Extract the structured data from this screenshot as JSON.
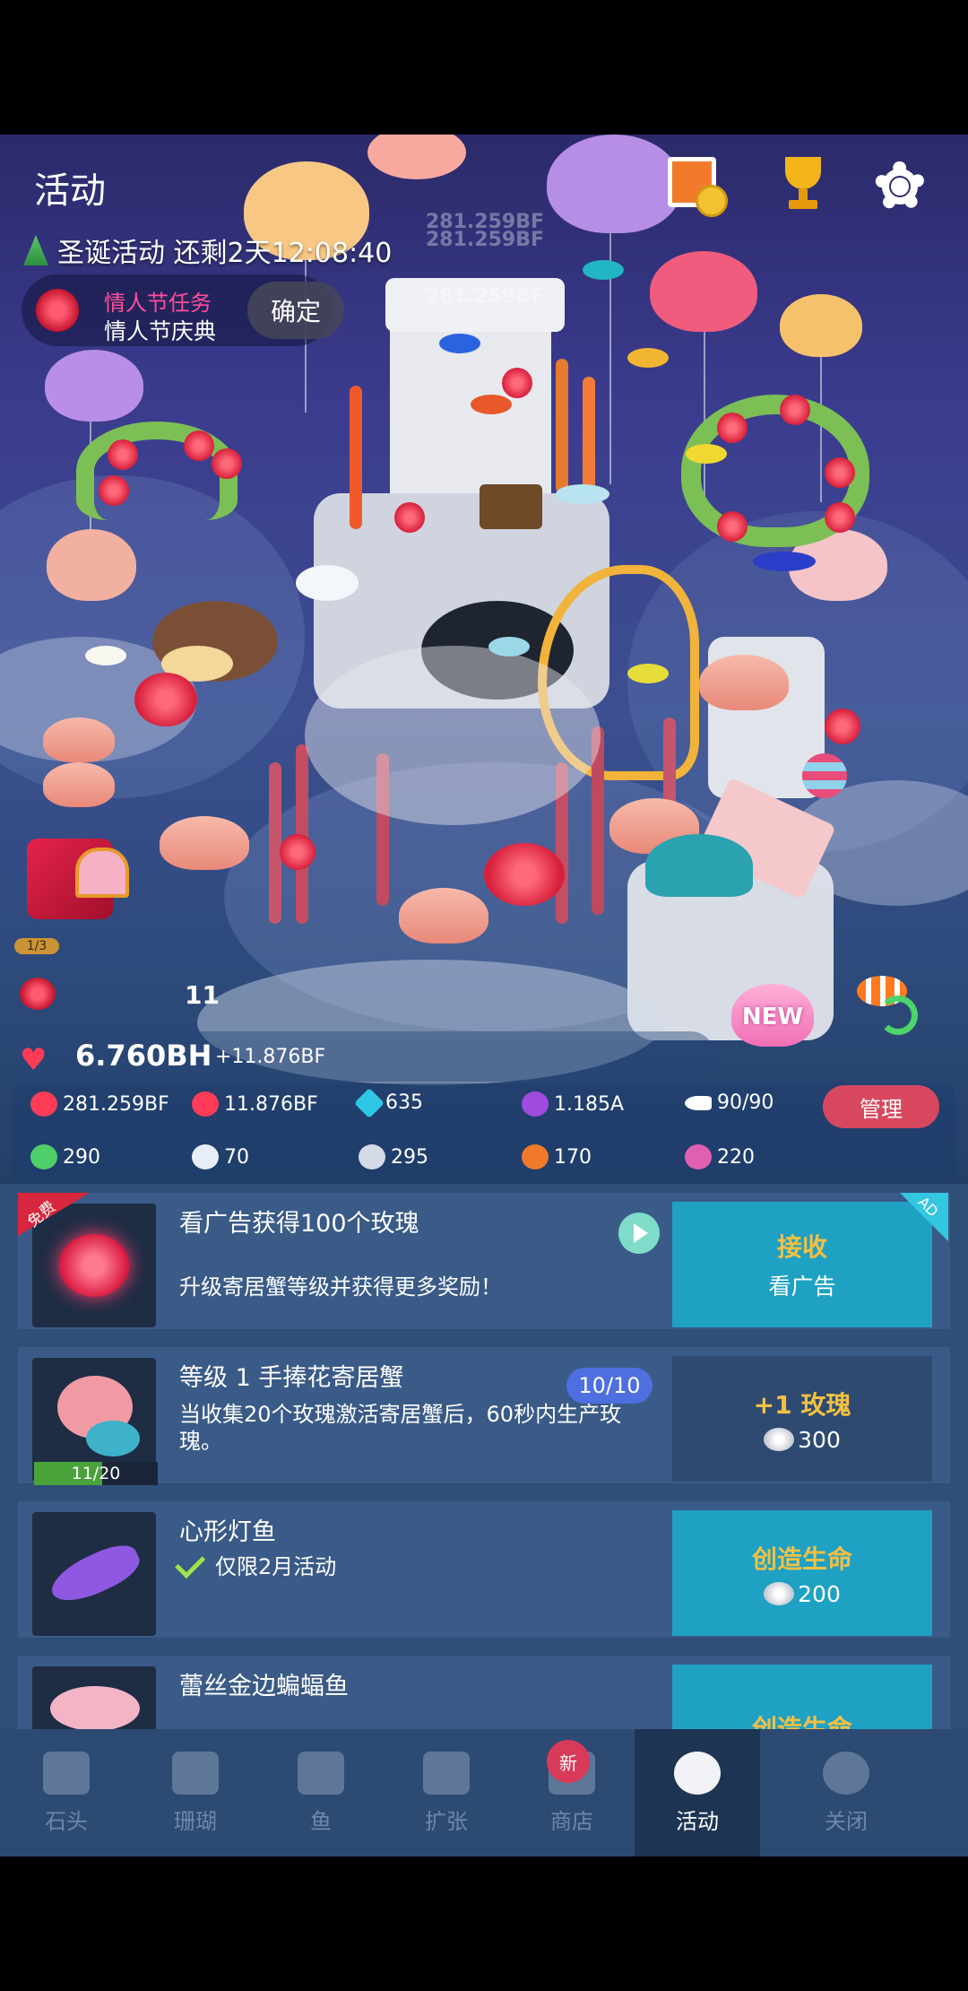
{
  "header": {
    "title": "活动",
    "event_countdown": "圣诞活动 还剩2天12:08:40"
  },
  "valentine": {
    "task": "情人节任务",
    "subtitle": "情人节庆典",
    "confirm_label": "确定"
  },
  "floating_numbers": [
    "281.259BF",
    "281.259BF",
    "281.259BF"
  ],
  "gift": {
    "progress": "1/3"
  },
  "rose_count": "11",
  "new_badge": "NEW",
  "love": {
    "total": "6.760BH",
    "rate": "+11.876BF"
  },
  "stats": {
    "tap_value": "281.259BF",
    "per_second": "11.876BF",
    "diamonds": "635",
    "pearls": "1.185A",
    "fish": "90/90",
    "manage_label": "管理",
    "res1": "290",
    "res2": "70",
    "res3": "295",
    "res4": "170",
    "res5": "220"
  },
  "list": [
    {
      "badge": "免费",
      "title": "看广告获得100个玫瑰",
      "desc": "升级寄居蟹等级并获得更多奖励！",
      "action_main": "接收",
      "action_sub": "看广告",
      "corner": "AD"
    },
    {
      "title": "等级 1 手捧花寄居蟹",
      "level": "10/10",
      "desc": "当收集20个玫瑰激活寄居蟹后，60秒内生产玫瑰。",
      "progress": "11/20",
      "progress_value": 0.55,
      "action_main": "+1 玫瑰",
      "action_cost": "300"
    },
    {
      "title": "心形灯鱼",
      "desc": "仅限2月活动",
      "action_main": "创造生命",
      "action_cost": "200"
    },
    {
      "title": "蕾丝金边蝙蝠鱼",
      "action_main": "创造生命"
    }
  ],
  "nav": {
    "items": [
      {
        "label": "石头",
        "icon": "stone-icon"
      },
      {
        "label": "珊瑚",
        "icon": "coral-icon"
      },
      {
        "label": "鱼",
        "icon": "fish-icon"
      },
      {
        "label": "扩张",
        "icon": "expand-icon"
      },
      {
        "label": "商店",
        "icon": "cart-icon"
      },
      {
        "label": "活动",
        "icon": "rose-icon"
      },
      {
        "label": "关闭",
        "icon": "close-down-icon"
      }
    ],
    "new_badge": "新",
    "active_index": 5
  },
  "colors": {
    "panel": "#2f4f79",
    "action_teal": "#1ea1c3",
    "gold_text": "#f2c044",
    "manage_red": "#d7485f"
  }
}
